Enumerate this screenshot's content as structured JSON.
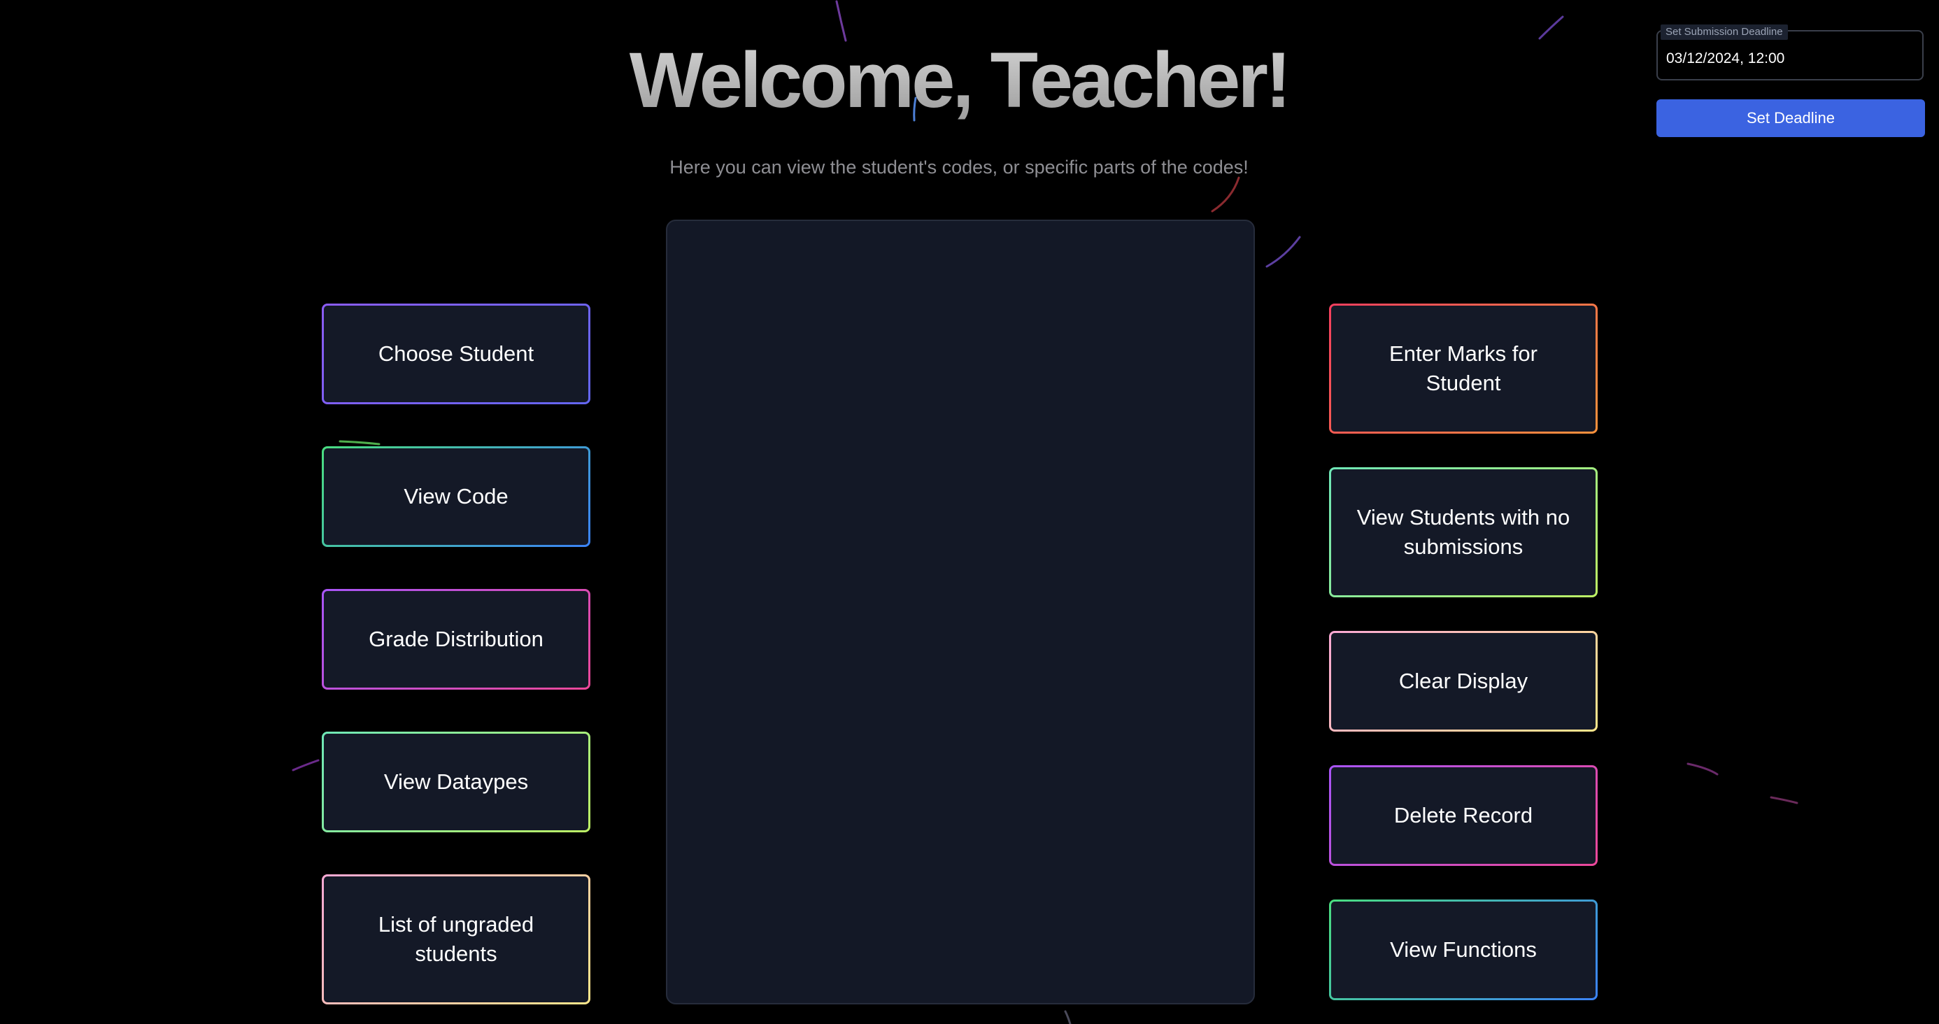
{
  "header": {
    "title": "Welcome, Teacher!",
    "subtitle": "Here you can view the student's codes, or specific parts of the codes!"
  },
  "deadline": {
    "label": "Set Submission Deadline",
    "value": "03/12/2024, 12:00",
    "button_label": "Set Deadline",
    "button_color": "#3b63e1"
  },
  "left_actions": [
    {
      "label": "Choose Student",
      "border_colors": [
        "#8b5cf6",
        "#6366f1"
      ]
    },
    {
      "label": "View Code",
      "border_colors": [
        "#4ade80",
        "#3b82f6"
      ]
    },
    {
      "label": "Grade Distribution",
      "border_colors": [
        "#a855f7",
        "#ec4899"
      ]
    },
    {
      "label": "View Dataypes",
      "border_colors": [
        "#6ee7b7",
        "#bef264"
      ]
    },
    {
      "label": "List of ungraded students",
      "border_colors": [
        "#f9a8d4",
        "#fde68a"
      ]
    }
  ],
  "right_actions": [
    {
      "label": "Enter Marks for Student",
      "border_colors": [
        "#f43f5e",
        "#fb923c"
      ]
    },
    {
      "label": "View Students with no submissions",
      "border_colors": [
        "#6ee7b7",
        "#bef264"
      ]
    },
    {
      "label": "Clear Display",
      "border_colors": [
        "#f9a8d4",
        "#fde68a"
      ]
    },
    {
      "label": "Delete Record",
      "border_colors": [
        "#a855f7",
        "#ec4899"
      ]
    },
    {
      "label": "View Functions",
      "border_colors": [
        "#4ade80",
        "#3b82f6"
      ]
    }
  ],
  "display": {
    "background": "#131826"
  }
}
